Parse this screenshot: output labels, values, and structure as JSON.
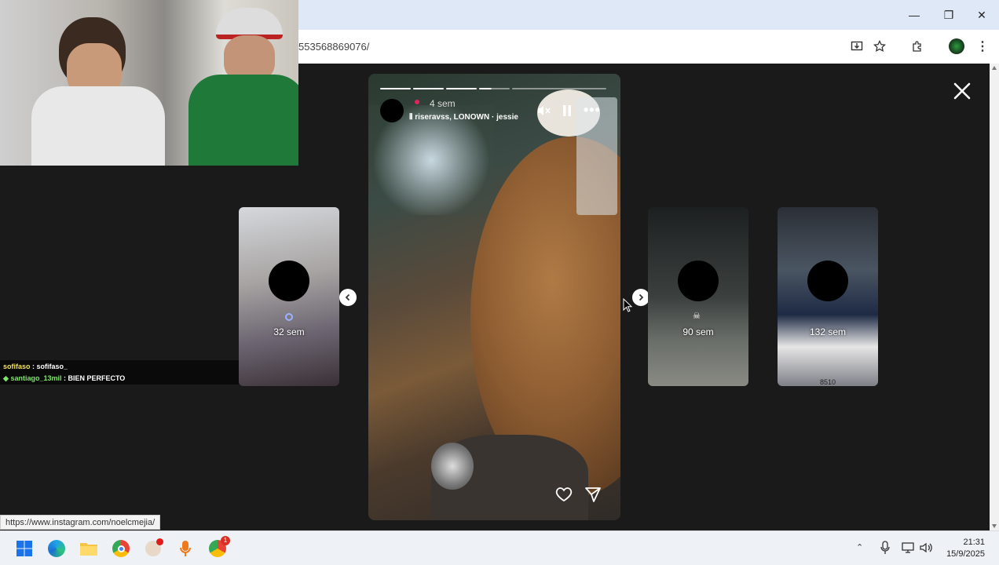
{
  "browser": {
    "url": "553568869076/",
    "window_controls": {
      "minimize": "—",
      "restore": "❐",
      "close": "✕"
    }
  },
  "stream_chat": [
    {
      "user": "sofifaso",
      "message": "sofifaso_",
      "user_color": "#f2e15a"
    },
    {
      "user": "santiago_13mil",
      "message": "BIEN PERFECTO",
      "user_color": "#7de36a",
      "badge": "◆"
    }
  ],
  "story": {
    "timestamp": "4 sem",
    "music": "riseravss, LONOWN · jessie",
    "progress_segments": 5,
    "progress_completed": 3
  },
  "side_stories": [
    {
      "time": "32 sem"
    },
    {
      "time": "90 sem"
    },
    {
      "time": "132 sem",
      "caption": "8510"
    }
  ],
  "status_bar": {
    "url": "https://www.instagram.com/noelcmejia/"
  },
  "taskbar": {
    "time": "21:31",
    "date": "15/9/2025",
    "badge": "1"
  }
}
